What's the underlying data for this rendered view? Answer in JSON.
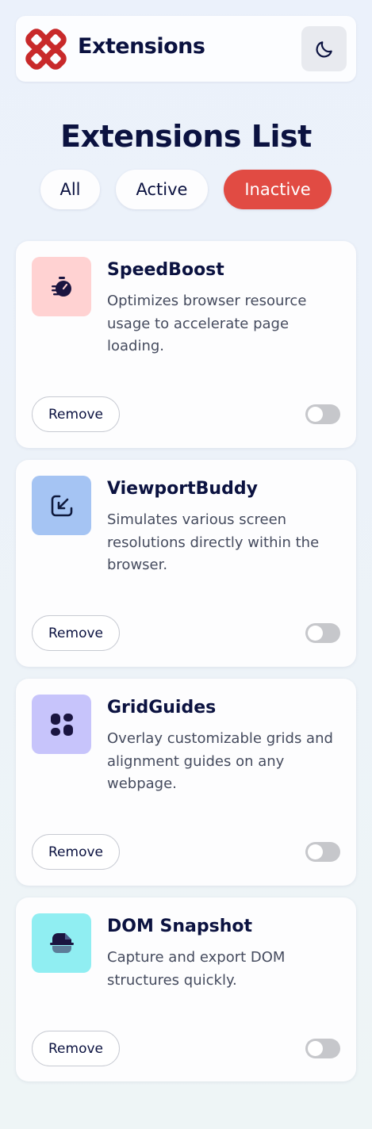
{
  "header": {
    "title": "Extensions",
    "logo_icon": "logo-icon",
    "theme_icon": "moon-icon"
  },
  "main": {
    "title": "Extensions List",
    "filters": [
      "All",
      "Active",
      "Inactive"
    ],
    "selected_filter": "Inactive"
  },
  "extensions": [
    {
      "name": "SpeedBoost",
      "description": "Optimizes browser resource usage to accelerate page loading.",
      "icon": "stopwatch-icon",
      "icon_bg": "#ffd2d2",
      "remove_label": "Remove",
      "enabled": false
    },
    {
      "name": "ViewportBuddy",
      "description": "Simulates various screen resolutions directly within the browser.",
      "icon": "resize-arrow-icon",
      "icon_bg": "#a5c4f3",
      "remove_label": "Remove",
      "enabled": false
    },
    {
      "name": "GridGuides",
      "description": "Overlay customizable grids and alignment guides on any webpage.",
      "icon": "grid-icon",
      "icon_bg": "#c7c4fb",
      "remove_label": "Remove",
      "enabled": false
    },
    {
      "name": "DOM Snapshot",
      "description": "Capture and export DOM structures quickly.",
      "icon": "snapshot-icon",
      "icon_bg": "#90eef2",
      "remove_label": "Remove",
      "enabled": false
    }
  ],
  "colors": {
    "accent": "#e14b43",
    "text": "#0b1240",
    "toggle_off": "#c6c7cb"
  }
}
